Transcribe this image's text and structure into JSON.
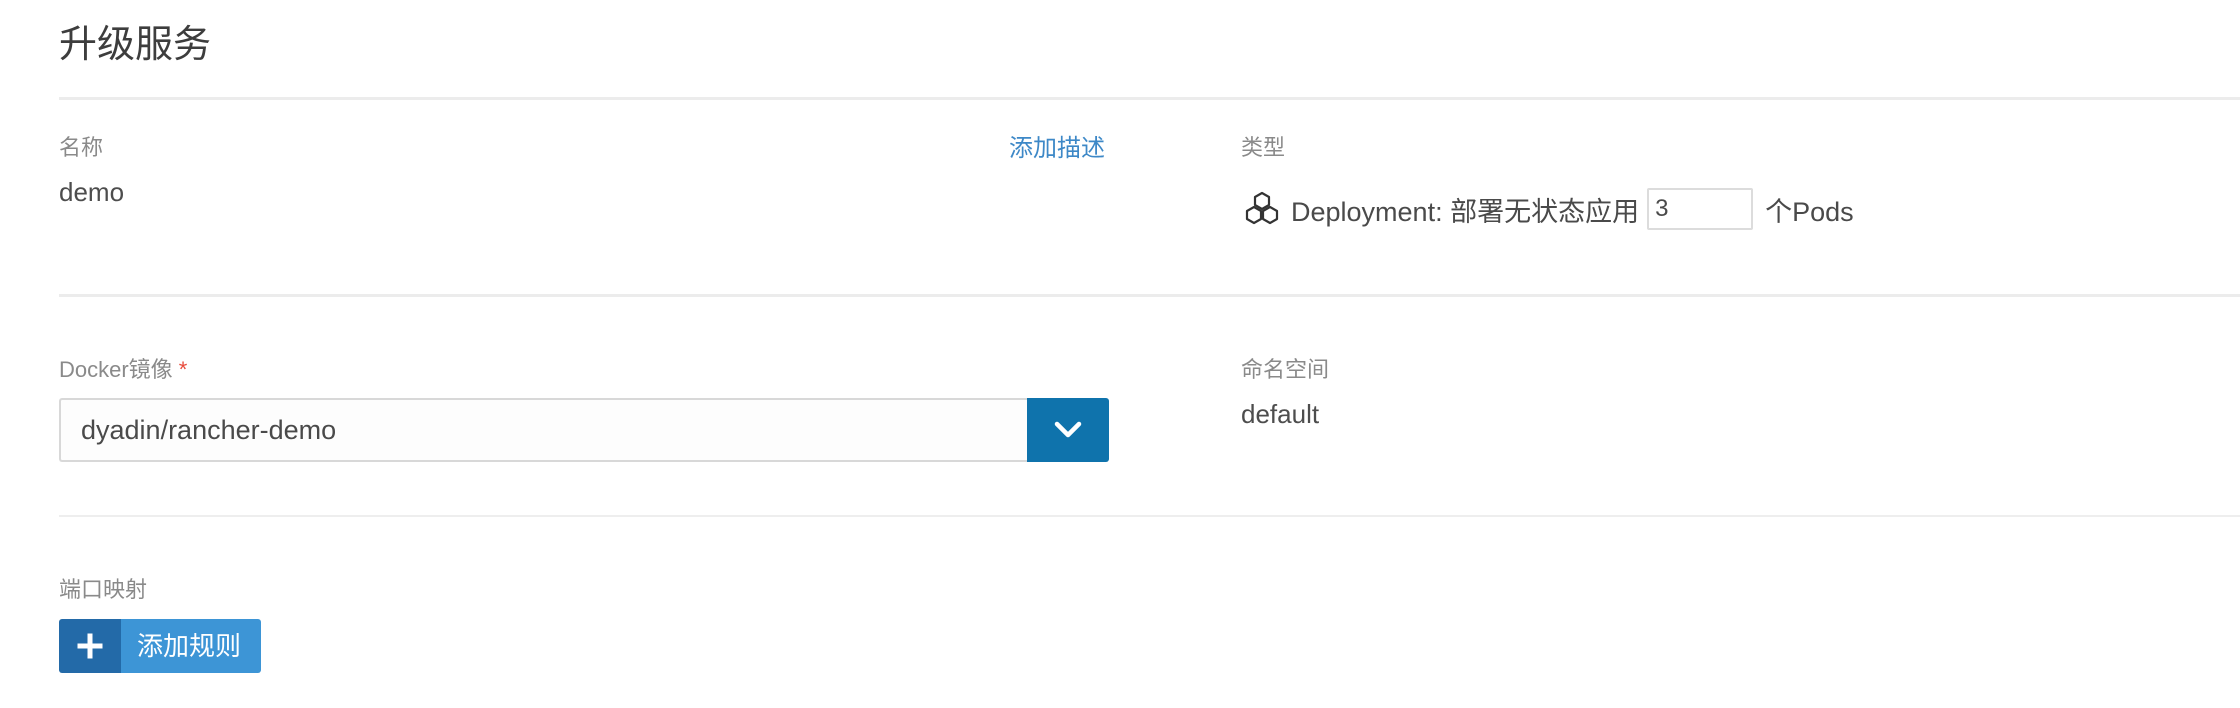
{
  "header": {
    "title": "升级服务"
  },
  "name_section": {
    "label": "名称",
    "value": "demo",
    "add_description_link": "添加描述"
  },
  "type_section": {
    "label": "类型",
    "icon": "deployment-icon",
    "deployment_text": "Deployment: 部署无状态应用",
    "pods_count": "3",
    "pods_suffix": "个Pods"
  },
  "image_section": {
    "label": "Docker镜像",
    "required_mark": "*",
    "value": "dyadin/rancher-demo",
    "dropdown_icon": "chevron-down-icon"
  },
  "namespace_section": {
    "label": "命名空间",
    "value": "default"
  },
  "port_mapping_section": {
    "label": "端口映射",
    "add_rule_button": "添加规则",
    "add_icon": "plus-icon"
  },
  "colors": {
    "link": "#3d88c7",
    "primary_button": "#0f73ac",
    "add_button_dark": "#236aa8",
    "add_button_light": "#3d95d6",
    "required": "#e84b3c"
  }
}
